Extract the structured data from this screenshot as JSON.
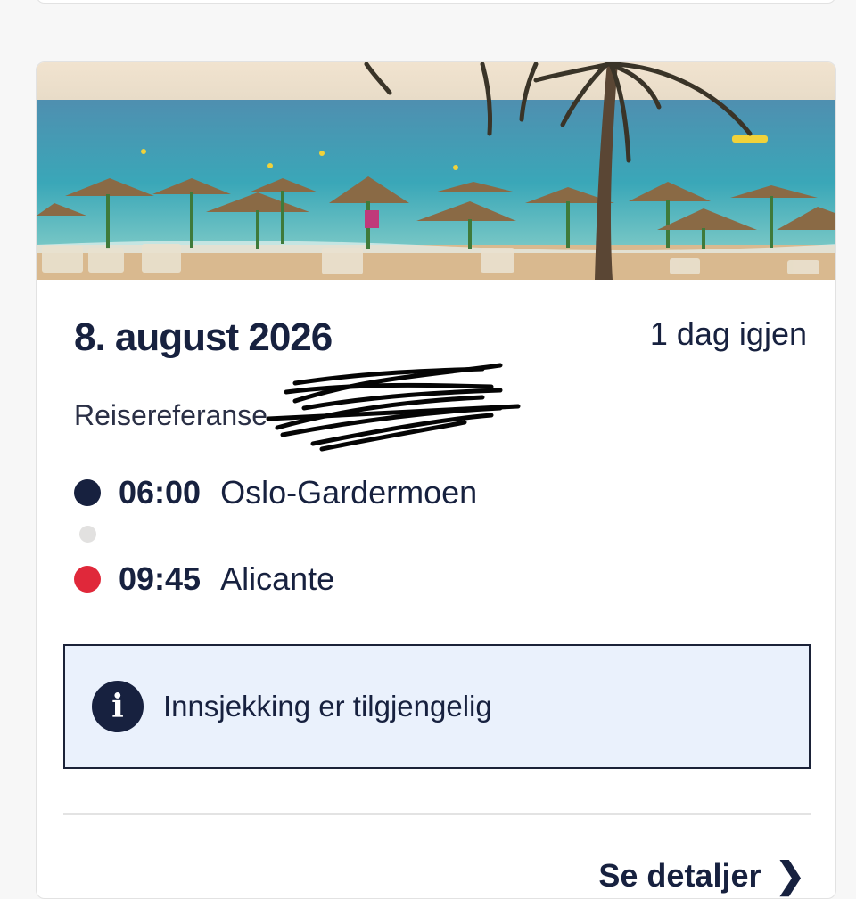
{
  "trip": {
    "date": "8. august 2026",
    "countdown": "1 dag igjen",
    "reference_label": "Reisereferanse",
    "departure": {
      "time": "06:00",
      "place": "Oslo-Gardermoen"
    },
    "arrival": {
      "time": "09:45",
      "place": "Alicante"
    }
  },
  "notice": {
    "text": "Innsjekking er tilgjengelig",
    "icon": "info-icon"
  },
  "details_link": {
    "label": "Se detaljer",
    "icon": "chevron-right-icon"
  },
  "colors": {
    "navy": "#17213f",
    "departure_dot": "#17213f",
    "stop_dot": "#e2e1e0",
    "arrival_dot": "#e0283a",
    "notice_bg": "#eaf1fc"
  }
}
